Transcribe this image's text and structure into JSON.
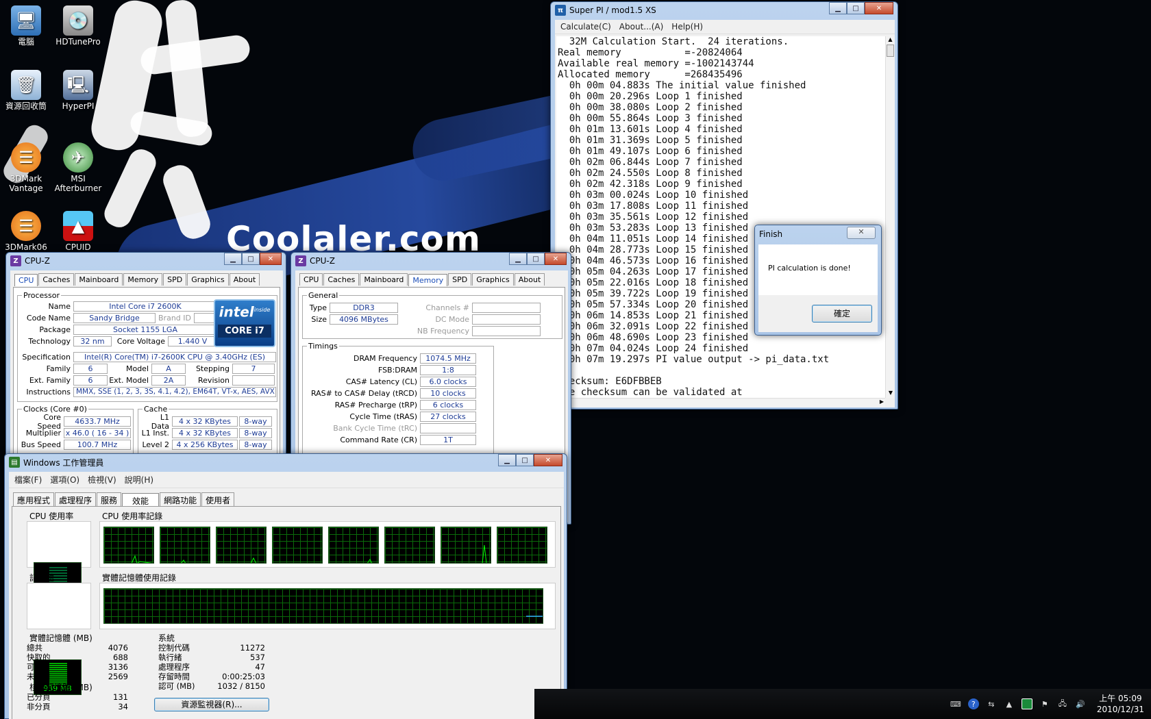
{
  "desktop": {
    "watermark": "Coolaler.com",
    "icons": [
      {
        "label": "電腦"
      },
      {
        "label": "HDTunePro"
      },
      {
        "label": "資源回收筒"
      },
      {
        "label": "HyperPI"
      },
      {
        "label": "3DMark Vantage"
      },
      {
        "label": "MSI Afterburner"
      },
      {
        "label": "3DMark06"
      },
      {
        "label": "CPUID"
      }
    ]
  },
  "superpi": {
    "title": "Super PI / mod1.5 XS",
    "menu": [
      "Calculate(C)",
      "About...(A)",
      "Help(H)"
    ],
    "lines": [
      "  32M Calculation Start.  24 iterations.",
      "Real memory           =-20824064",
      "Available real memory =-1002143744",
      "Allocated memory      =268435496",
      "  0h 00m 04.883s The initial value finished",
      "  0h 00m 20.296s Loop 1 finished",
      "  0h 00m 38.080s Loop 2 finished",
      "  0h 00m 55.864s Loop 3 finished",
      "  0h 01m 13.601s Loop 4 finished",
      "  0h 01m 31.369s Loop 5 finished",
      "  0h 01m 49.107s Loop 6 finished",
      "  0h 02m 06.844s Loop 7 finished",
      "  0h 02m 24.550s Loop 8 finished",
      "  0h 02m 42.318s Loop 9 finished",
      "  0h 03m 00.024s Loop 10 finished",
      "  0h 03m 17.808s Loop 11 finished",
      "  0h 03m 35.561s Loop 12 finished",
      "  0h 03m 53.283s Loop 13 finished",
      "  0h 04m 11.051s Loop 14 finished",
      "  0h 04m 28.773s Loop 15 finished",
      "  0h 04m 46.573s Loop 16 finished",
      "  0h 05m 04.263s Loop 17 finished",
      "  0h 05m 22.016s Loop 18 finished",
      "  0h 05m 39.722s Loop 19 finished",
      "  0h 05m 57.334s Loop 20 finished",
      "  0h 06m 14.853s Loop 21 finished",
      "  0h 06m 32.091s Loop 22 finished",
      "  0h 06m 48.690s Loop 23 finished",
      "  0h 07m 04.024s Loop 24 finished",
      "  0h 07m 19.297s PI value output -> pi_data.txt",
      "",
      "Checksum: E6DFBBEB",
      "The checksum can be validated at"
    ]
  },
  "finish_dialog": {
    "title": "Finish",
    "message": "PI calculation is done!",
    "ok": "確定"
  },
  "cpuz1": {
    "title": "CPU-Z",
    "tabs": [
      "CPU",
      "Caches",
      "Mainboard",
      "Memory",
      "SPD",
      "Graphics",
      "About"
    ],
    "processor_legend": "Processor",
    "name_lbl": "Name",
    "name": "Intel Core i7 2600K",
    "codename_lbl": "Code Name",
    "codename": "Sandy Bridge",
    "brandid_lbl": "Brand ID",
    "package_lbl": "Package",
    "package": "Socket 1155 LGA",
    "tech_lbl": "Technology",
    "tech": "32 nm",
    "voltage_lbl": "Core Voltage",
    "voltage": "1.440 V",
    "spec_lbl": "Specification",
    "spec": "Intel(R) Core(TM) i7-2600K CPU @ 3.40GHz (ES)",
    "family_lbl": "Family",
    "family": "6",
    "model_lbl": "Model",
    "model": "A",
    "stepping_lbl": "Stepping",
    "stepping": "7",
    "extfamily_lbl": "Ext. Family",
    "extfamily": "6",
    "extmodel_lbl": "Ext. Model",
    "extmodel": "2A",
    "revision_lbl": "Revision",
    "instr_lbl": "Instructions",
    "instr": "MMX, SSE (1, 2, 3, 3S, 4.1, 4.2), EM64T, VT-x, AES, AVX",
    "logo_brand": "intel",
    "logo_inside": "inside",
    "logo_core": "CORE i7",
    "clocks_legend": "Clocks (Core #0)",
    "corespeed_lbl": "Core Speed",
    "corespeed": "4633.7 MHz",
    "mult_lbl": "Multiplier",
    "mult": "x 46.0 ( 16 - 34 )",
    "bus_lbl": "Bus Speed",
    "bus": "100.7 MHz",
    "cache_legend": "Cache",
    "l1d_lbl": "L1 Data",
    "l1d": "4 x 32 KBytes",
    "l1d_way": "8-way",
    "l1i_lbl": "L1 Inst.",
    "l1i": "4 x 32 KBytes",
    "l1i_way": "8-way",
    "l2_lbl": "Level 2",
    "l2": "4 x 256 KBytes",
    "l2_way": "8-way"
  },
  "cpuz2": {
    "title": "CPU-Z",
    "tabs": [
      "CPU",
      "Caches",
      "Mainboard",
      "Memory",
      "SPD",
      "Graphics",
      "About"
    ],
    "general_legend": "General",
    "type_lbl": "Type",
    "type": "DDR3",
    "size_lbl": "Size",
    "size": "4096 MBytes",
    "channels_lbl": "Channels #",
    "dcmode_lbl": "DC Mode",
    "nbfreq_lbl": "NB Frequency",
    "timings_legend": "Timings",
    "timings": [
      {
        "label": "DRAM Frequency",
        "value": "1074.5 MHz"
      },
      {
        "label": "FSB:DRAM",
        "value": "1:8"
      },
      {
        "label": "CAS# Latency (CL)",
        "value": "6.0 clocks"
      },
      {
        "label": "RAS# to CAS# Delay (tRCD)",
        "value": "10 clocks"
      },
      {
        "label": "RAS# Precharge (tRP)",
        "value": "6 clocks"
      },
      {
        "label": "Cycle Time (tRAS)",
        "value": "27 clocks"
      },
      {
        "label": "Bank Cycle Time (tRC)",
        "value": ""
      },
      {
        "label": "Command Rate (CR)",
        "value": "1T"
      }
    ]
  },
  "taskmgr": {
    "title": "Windows 工作管理員",
    "menu": [
      "檔案(F)",
      "選項(O)",
      "檢視(V)",
      "說明(H)"
    ],
    "tabs": [
      "應用程式",
      "處理程序",
      "服務",
      "效能",
      "網路功能",
      "使用者"
    ],
    "cpu_usage_lbl": "CPU 使用率",
    "cpu_usage": "0 %",
    "cpu_history_lbl": "CPU 使用率記錄",
    "mem_lbl": "記憶體",
    "mem_value": "939 MB",
    "mem_history_lbl": "實體記憶體使用記錄",
    "physical_lbl": "實體記憶體 (MB)",
    "physical": [
      {
        "k": "總共",
        "v": "4076"
      },
      {
        "k": "快取的",
        "v": "688"
      },
      {
        "k": "可用",
        "v": "3136"
      },
      {
        "k": "未使用",
        "v": "2569"
      }
    ],
    "kernel_lbl": "核心記憶體 (MB)",
    "kernel": [
      {
        "k": "已分頁",
        "v": "131"
      },
      {
        "k": "非分頁",
        "v": "34"
      }
    ],
    "system_lbl": "系統",
    "system": [
      {
        "k": "控制代碼",
        "v": "11272"
      },
      {
        "k": "執行緒",
        "v": "537"
      },
      {
        "k": "處理程序",
        "v": "47"
      },
      {
        "k": "存留時間",
        "v": "0:00:25:03"
      },
      {
        "k": "認可 (MB)",
        "v": "1032 / 8150"
      }
    ],
    "resmon_button": "資源監視器(R)..."
  },
  "taskbar": {
    "time": "上午 05:09",
    "date": "2010/12/31"
  },
  "colors": {
    "graph_green": "#00ff00",
    "accent": "#1a4db8"
  }
}
